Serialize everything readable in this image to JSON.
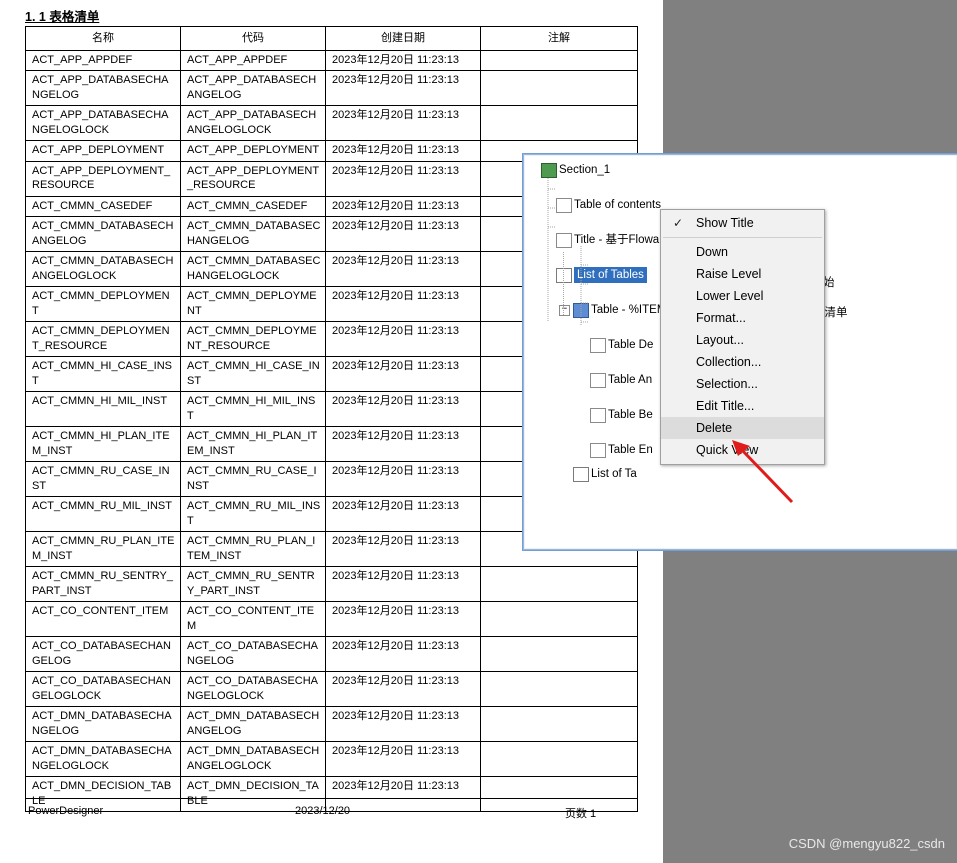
{
  "document": {
    "heading": "1. 1  表格清单",
    "columns": [
      "名称",
      "代码",
      "创建日期",
      "注解"
    ],
    "rows": [
      {
        "name": "ACT_APP_APPDEF",
        "code": "ACT_APP_APPDEF",
        "date": "2023年12月20日 11:23:13",
        "note": ""
      },
      {
        "name": "ACT_APP_DATABASECHANGELOG",
        "code": "ACT_APP_DATABASECHANGELOG",
        "date": "2023年12月20日 11:23:13",
        "note": ""
      },
      {
        "name": "ACT_APP_DATABASECHANGELOGLOCK",
        "code": "ACT_APP_DATABASECHANGELOGLOCK",
        "date": "2023年12月20日 11:23:13",
        "note": ""
      },
      {
        "name": "ACT_APP_DEPLOYMENT",
        "code": "ACT_APP_DEPLOYMENT",
        "date": "2023年12月20日 11:23:13",
        "note": ""
      },
      {
        "name": "ACT_APP_DEPLOYMENT_RESOURCE",
        "code": "ACT_APP_DEPLOYMENT_RESOURCE",
        "date": "2023年12月20日 11:23:13",
        "note": ""
      },
      {
        "name": "ACT_CMMN_CASEDEF",
        "code": "ACT_CMMN_CASEDEF",
        "date": "2023年12月20日 11:23:13",
        "note": ""
      },
      {
        "name": "ACT_CMMN_DATABASECHANGELOG",
        "code": "ACT_CMMN_DATABASECHANGELOG",
        "date": "2023年12月20日 11:23:13",
        "note": ""
      },
      {
        "name": "ACT_CMMN_DATABASECHANGELOGLOCK",
        "code": "ACT_CMMN_DATABASECHANGELOGLOCK",
        "date": "2023年12月20日 11:23:13",
        "note": ""
      },
      {
        "name": "ACT_CMMN_DEPLOYMENT",
        "code": "ACT_CMMN_DEPLOYMENT",
        "date": "2023年12月20日 11:23:13",
        "note": ""
      },
      {
        "name": "ACT_CMMN_DEPLOYMENT_RESOURCE",
        "code": "ACT_CMMN_DEPLOYMENT_RESOURCE",
        "date": "2023年12月20日 11:23:13",
        "note": ""
      },
      {
        "name": "ACT_CMMN_HI_CASE_INST",
        "code": "ACT_CMMN_HI_CASE_INST",
        "date": "2023年12月20日 11:23:13",
        "note": ""
      },
      {
        "name": "ACT_CMMN_HI_MIL_INST",
        "code": "ACT_CMMN_HI_MIL_INST",
        "date": "2023年12月20日 11:23:13",
        "note": ""
      },
      {
        "name": "ACT_CMMN_HI_PLAN_ITEM_INST",
        "code": "ACT_CMMN_HI_PLAN_ITEM_INST",
        "date": "2023年12月20日 11:23:13",
        "note": ""
      },
      {
        "name": "ACT_CMMN_RU_CASE_INST",
        "code": "ACT_CMMN_RU_CASE_INST",
        "date": "2023年12月20日 11:23:13",
        "note": ""
      },
      {
        "name": "ACT_CMMN_RU_MIL_INST",
        "code": "ACT_CMMN_RU_MIL_INST",
        "date": "2023年12月20日 11:23:13",
        "note": ""
      },
      {
        "name": "ACT_CMMN_RU_PLAN_ITEM_INST",
        "code": "ACT_CMMN_RU_PLAN_ITEM_INST",
        "date": "2023年12月20日 11:23:13",
        "note": ""
      },
      {
        "name": "ACT_CMMN_RU_SENTRY_PART_INST",
        "code": "ACT_CMMN_RU_SENTRY_PART_INST",
        "date": "2023年12月20日 11:23:13",
        "note": ""
      },
      {
        "name": "ACT_CO_CONTENT_ITEM",
        "code": "ACT_CO_CONTENT_ITEM",
        "date": "2023年12月20日 11:23:13",
        "note": ""
      },
      {
        "name": "ACT_CO_DATABASECHANGELOG",
        "code": "ACT_CO_DATABASECHANGELOG",
        "date": "2023年12月20日 11:23:13",
        "note": ""
      },
      {
        "name": "ACT_CO_DATABASECHANGELOGLOCK",
        "code": "ACT_CO_DATABASECHANGELOGLOCK",
        "date": "2023年12月20日 11:23:13",
        "note": ""
      },
      {
        "name": "ACT_DMN_DATABASECHANGELOG",
        "code": "ACT_DMN_DATABASECHANGELOG",
        "date": "2023年12月20日 11:23:13",
        "note": ""
      },
      {
        "name": "ACT_DMN_DATABASECHANGELOGLOCK",
        "code": "ACT_DMN_DATABASECHANGELOGLOCK",
        "date": "2023年12月20日 11:23:13",
        "note": ""
      },
      {
        "name": "ACT_DMN_DECISION_TABLE",
        "code": "ACT_DMN_DECISION_TABLE",
        "date": "2023年12月20日 11:23:13",
        "note": ""
      }
    ],
    "footer": {
      "left": "PowerDesigner",
      "center": "2023/12/20",
      "right": "页数 1"
    }
  },
  "tree": {
    "nodes": [
      {
        "label": "Section_1",
        "icon": "section-icon"
      },
      {
        "label": "Table of contents",
        "icon": "page-icon"
      },
      {
        "label": "Title - 基于Flowable工作流数据字典",
        "icon": "page-icon"
      },
      {
        "label": "List of Tables",
        "icon": "list-icon",
        "selected": true
      },
      {
        "label": "Table - %ITEM%",
        "icon": "table-icon"
      },
      {
        "label": "Table De",
        "icon": "page-icon"
      },
      {
        "label": "Table An",
        "icon": "page-icon"
      },
      {
        "label": "Table Be",
        "icon": "page-icon"
      },
      {
        "label": "Table En",
        "icon": "page-icon"
      },
      {
        "label": "List of Ta",
        "icon": "list-icon"
      }
    ],
    "ghost_right": [
      "始",
      "列清单"
    ]
  },
  "context_menu": {
    "items": [
      {
        "label": "Show Title",
        "checked": true,
        "highlight": false
      },
      {
        "label": "Down",
        "checked": false,
        "highlight": false
      },
      {
        "label": "Raise Level",
        "checked": false,
        "highlight": false
      },
      {
        "label": "Lower Level",
        "checked": false,
        "highlight": false
      },
      {
        "label": "Format...",
        "checked": false,
        "highlight": false
      },
      {
        "label": "Layout...",
        "checked": false,
        "highlight": false
      },
      {
        "label": "Collection...",
        "checked": false,
        "highlight": false
      },
      {
        "label": "Selection...",
        "checked": false,
        "highlight": false
      },
      {
        "label": "Edit Title...",
        "checked": false,
        "highlight": false
      },
      {
        "label": "Delete",
        "checked": false,
        "highlight": true
      },
      {
        "label": "Quick View",
        "checked": false,
        "highlight": false
      }
    ]
  },
  "watermark": "CSDN @mengyu822_csdn"
}
